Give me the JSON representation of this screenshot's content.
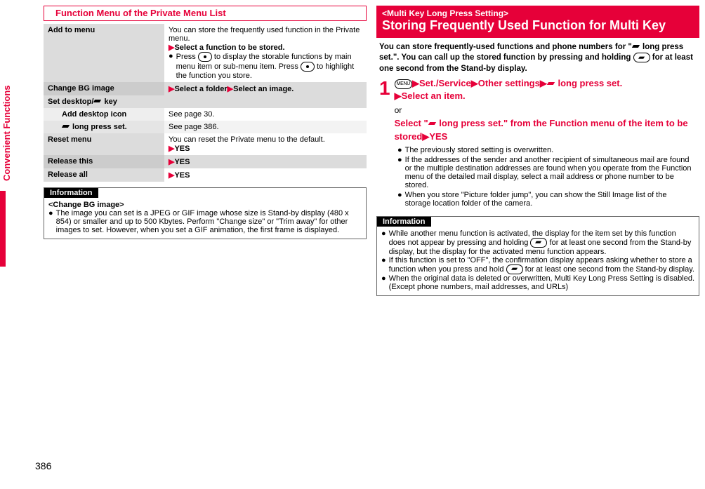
{
  "pageNumber": "386",
  "sideTab": "Convenient Functions",
  "left": {
    "sectionTitle": "Function Menu of the Private Menu List",
    "rows": {
      "addToMenu": {
        "k": "Add to menu",
        "line1": "You can store the frequently used function in the Private menu.",
        "line2": "Select a function to be stored.",
        "line3a": "Press ",
        "line3b": " to display the storable functions by main menu item or sub-menu item. Press ",
        "line3c": " to highlight the function you store."
      },
      "changeBg": {
        "k": "Change BG image",
        "v1": "Select a folder",
        "v2": "Select an image."
      },
      "setDesktop": {
        "k": "Set desktop/",
        "k2": " key"
      },
      "addDesktopIcon": {
        "k": "Add desktop icon",
        "v": "See page 30."
      },
      "longPressSet": {
        "k": " long press set.",
        "v": "See page 386."
      },
      "resetMenu": {
        "k": "Reset menu",
        "v1": "You can reset the Private menu to the default.",
        "v2": "YES"
      },
      "releaseThis": {
        "k": "Release this",
        "v": "YES"
      },
      "releaseAll": {
        "k": "Release all",
        "v": "YES"
      }
    },
    "info": {
      "label": "Information",
      "grpTitle": "<Change BG image>",
      "body": "The image you can set is a JPEG or GIF image whose size is Stand-by display (480 x 854) or smaller and up to 500 Kbytes. Perform \"Change size\" or \"Trim away\" for other images to set. However, when you set a GIF animation, the first frame is displayed."
    }
  },
  "right": {
    "sup": "<Multi Key Long Press Setting>",
    "title": "Storing Frequently Used Function for Multi Key",
    "introA": "You can store frequently-used functions and phone numbers for \"",
    "introB": " long press set.\". You can call up the stored function by pressing and holding ",
    "introC": " for at least one second from the Stand-by display.",
    "step": {
      "menu": "MENU",
      "p1": "Set./Service",
      "p2": "Other settings",
      "p3": " long press set.",
      "p4": "Select an item.",
      "or": "or",
      "alt1": "Select \"",
      "alt2": " long press set.\" from the Function menu of the item to be stored",
      "alt3": "YES"
    },
    "notes": {
      "n1": "The previously stored setting is overwritten.",
      "n2": "If the addresses of the sender and another recipient of simultaneous mail are found or the multiple destination addresses are found when you operate from the Function menu of the detailed mail display, select a mail address or phone number to be stored.",
      "n3": "When you store \"Picture folder jump\", you can show the Still Image list of the storage location folder of the camera."
    },
    "info": {
      "label": "Information",
      "n1a": "While another menu function is activated, the display for the item set by this function does not appear by pressing and holding ",
      "n1b": " for at least one second from the Stand-by display, but the display for the activated menu function appears.",
      "n2a": "If this function is set to \"OFF\", the confirmation display appears asking whether to store a function when you press and hold ",
      "n2b": " for at least one second from the Stand-by display.",
      "n3": "When the original data is deleted or overwritten, Multi Key Long Press Setting is disabled. (Except phone numbers, mail addresses, and URLs)"
    }
  }
}
